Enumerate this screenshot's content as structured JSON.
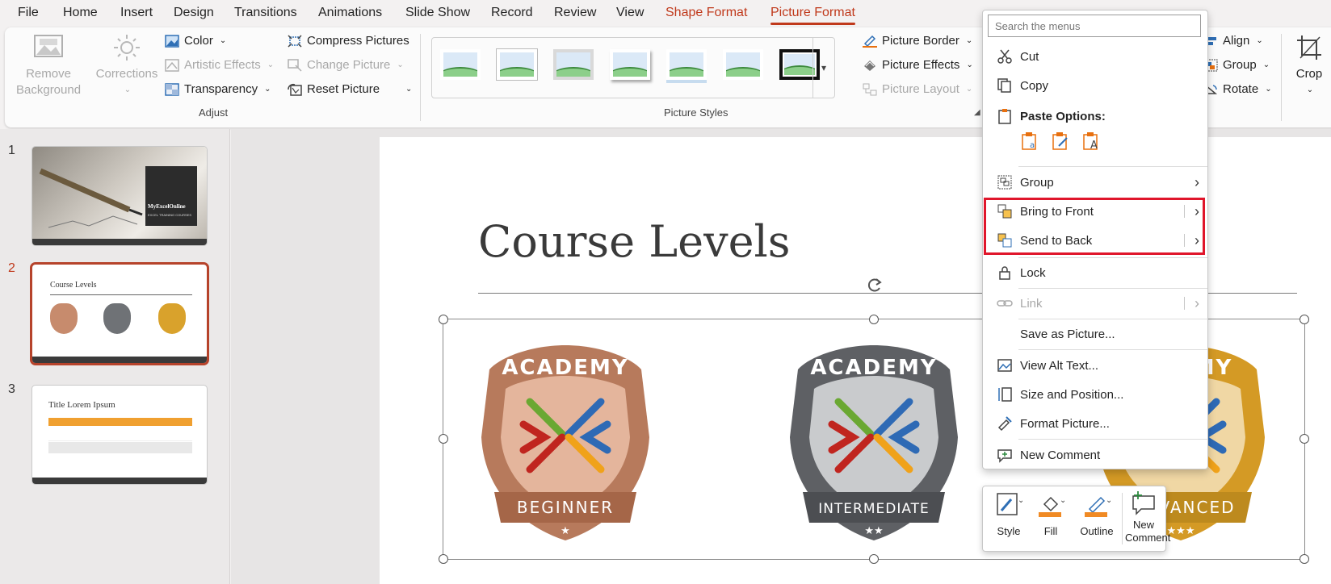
{
  "tabs": [
    "File",
    "Home",
    "Insert",
    "Design",
    "Transitions",
    "Animations",
    "Slide Show",
    "Record",
    "Review",
    "View",
    "Shape Format",
    "Picture Format"
  ],
  "ribbon": {
    "remove_background": "Remove Background",
    "corrections": "Corrections",
    "color": "Color",
    "artistic_effects": "Artistic Effects",
    "transparency": "Transparency",
    "compress_pictures": "Compress Pictures",
    "change_picture": "Change Picture",
    "reset_picture": "Reset Picture",
    "adjust_label": "Adjust",
    "picture_styles_label": "Picture Styles",
    "picture_border": "Picture Border",
    "picture_effects": "Picture Effects",
    "picture_layout": "Picture Layout",
    "align": "Align",
    "group": "Group",
    "rotate": "Rotate",
    "crop": "Crop"
  },
  "slides": [
    {
      "number": "1",
      "title": "MyExcelOnline",
      "subtitle": "EXCEL TRAINING COURSES"
    },
    {
      "number": "2",
      "title": "Course Levels"
    },
    {
      "number": "3",
      "title": "Title Lorem Ipsum"
    }
  ],
  "slide": {
    "title": "Course Levels",
    "badges": [
      {
        "top": "ACADEMY",
        "bottom": "BEGINNER",
        "stars": "★",
        "color": "#c78b6d"
      },
      {
        "top": "ACADEMY",
        "bottom": "INTERMEDIATE",
        "stars": "★★",
        "color": "#6f7276"
      },
      {
        "top": "MY",
        "bottom": "VANCED",
        "stars": "★★★",
        "color": "#d9a22c"
      }
    ]
  },
  "context_menu": {
    "search_placeholder": "Search the menus",
    "cut": "Cut",
    "copy": "Copy",
    "paste_options": "Paste Options:",
    "group": "Group",
    "bring_to_front": "Bring to Front",
    "send_to_back": "Send to Back",
    "lock": "Lock",
    "link": "Link",
    "save_as_picture": "Save as Picture...",
    "view_alt_text": "View Alt Text...",
    "size_and_position": "Size and Position...",
    "format_picture": "Format Picture...",
    "new_comment": "New Comment"
  },
  "mini_toolbar": {
    "style": "Style",
    "fill": "Fill",
    "outline": "Outline",
    "new_comment_line1": "New",
    "new_comment_line2": "Comment"
  },
  "colors": {
    "accent": "#c0391b",
    "highlight_box": "#e0162b"
  }
}
